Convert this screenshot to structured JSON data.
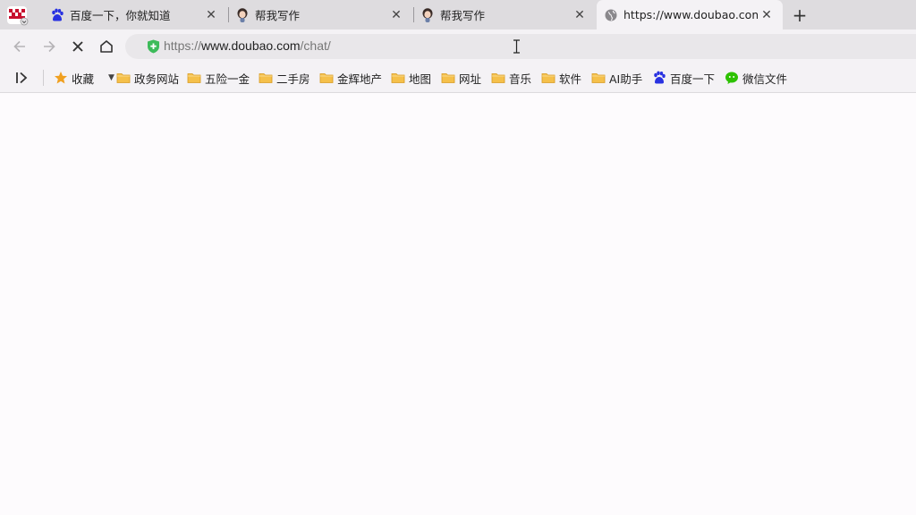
{
  "tabs": [
    {
      "title": "百度一下，你就知道",
      "favicon": "baidu-paw-icon",
      "active": false
    },
    {
      "title": "帮我写作",
      "favicon": "doubao-avatar-icon",
      "active": false
    },
    {
      "title": "帮我写作",
      "favicon": "doubao-avatar-icon",
      "active": false
    },
    {
      "title": "https://www.doubao.com/",
      "favicon": "globe-icon",
      "active": true
    }
  ],
  "address": {
    "scheme": "https://",
    "host": "www.doubao.com",
    "path": "/chat/"
  },
  "bookmarks": [
    {
      "label": "收藏",
      "icon": "star-icon"
    },
    {
      "label": "政务网站",
      "icon": "folder-icon"
    },
    {
      "label": "五险一金",
      "icon": "folder-icon"
    },
    {
      "label": "二手房",
      "icon": "folder-icon"
    },
    {
      "label": "金辉地产",
      "icon": "folder-icon"
    },
    {
      "label": "地图",
      "icon": "folder-icon"
    },
    {
      "label": "网址",
      "icon": "folder-icon"
    },
    {
      "label": "音乐",
      "icon": "folder-icon"
    },
    {
      "label": "软件",
      "icon": "folder-icon"
    },
    {
      "label": "AI助手",
      "icon": "folder-icon"
    },
    {
      "label": "百度一下",
      "icon": "baidu-paw-icon"
    },
    {
      "label": "微信文件",
      "icon": "wechat-icon"
    }
  ],
  "colors": {
    "tabstrip": "#dedcdf",
    "toolbar": "#f4f2f5",
    "folder": "#f5c04a",
    "star": "#f0a020",
    "shield": "#3dbb5a",
    "baidu": "#2932e1",
    "wechat": "#2dc100"
  }
}
